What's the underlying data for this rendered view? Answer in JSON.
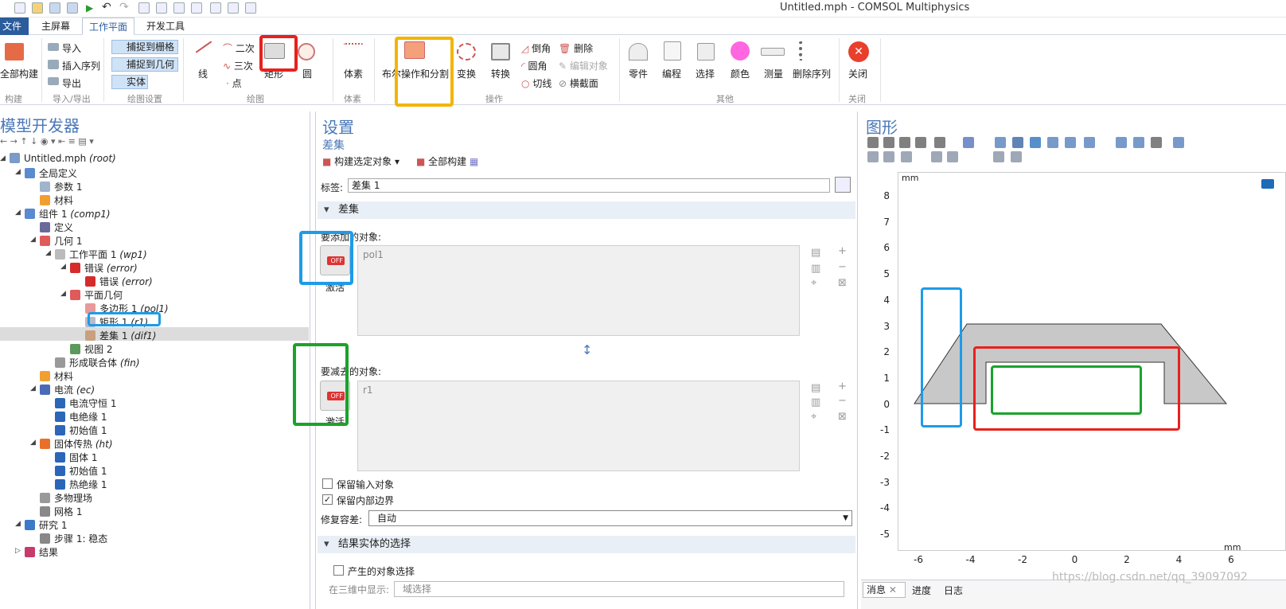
{
  "window": {
    "title": "Untitled.mph - COMSOL Multiphysics"
  },
  "tabs": {
    "file": "文件 ▾",
    "home": "主屏幕",
    "workplane": "工作平面",
    "devtools": "开发工具"
  },
  "ribbon": {
    "build_all": "全部构建",
    "group_build": "构建",
    "import": "导入",
    "insert_sequence": "插入序列",
    "export": "导出",
    "group_io": "导入/导出",
    "snap_grid": "捕捉到栅格",
    "snap_geometry": "捕捉到几何",
    "solid": "实体",
    "group_draw_settings": "绘图设置",
    "line": "线",
    "quadratic": "二次",
    "cubic": "三次",
    "point": "点",
    "rectangle": "矩形",
    "circle": "圆",
    "group_draw": "绘图",
    "primitive": "体素",
    "group_primitive": "体素",
    "boolean": "布尔操作和分割",
    "transform": "变换",
    "convert": "转换",
    "chamfer": "倒角",
    "fillet": "圆角",
    "tangent": "切线",
    "delete": "删除",
    "edit_object": "编辑对象",
    "cross_section": "横截面",
    "group_ops": "操作",
    "parts": "零件",
    "programming": "编程",
    "selection": "选择",
    "color": "颜色",
    "measure": "测量",
    "delete_sequence": "删除序列",
    "group_other": "其他",
    "close": "关闭",
    "group_close": "关闭"
  },
  "left_panel": {
    "title": "模型开发器",
    "tree": [
      {
        "label": "Untitled.mph",
        "suffix": "(root)"
      },
      {
        "label": "全局定义",
        "suffix": ""
      },
      {
        "label": "参数 1",
        "suffix": ""
      },
      {
        "label": "材料",
        "suffix": ""
      },
      {
        "label": "组件 1",
        "suffix": "(comp1)"
      },
      {
        "label": "定义",
        "suffix": ""
      },
      {
        "label": "几何 1",
        "suffix": ""
      },
      {
        "label": "工作平面 1",
        "suffix": "(wp1)"
      },
      {
        "label": "错误",
        "suffix": "(error)"
      },
      {
        "label": "错误",
        "suffix": "(error)"
      },
      {
        "label": "平面几何",
        "suffix": ""
      },
      {
        "label": "多边形 1",
        "suffix": "(pol1)"
      },
      {
        "label": "矩形 1",
        "suffix": "(r1)"
      },
      {
        "label": "差集 1",
        "suffix": "(dif1)"
      },
      {
        "label": "视图 2",
        "suffix": ""
      },
      {
        "label": "形成联合体",
        "suffix": "(fin)"
      },
      {
        "label": "材料",
        "suffix": ""
      },
      {
        "label": "电流",
        "suffix": "(ec)"
      },
      {
        "label": "电流守恒 1",
        "suffix": ""
      },
      {
        "label": "电绝缘 1",
        "suffix": ""
      },
      {
        "label": "初始值 1",
        "suffix": ""
      },
      {
        "label": "固体传热",
        "suffix": "(ht)"
      },
      {
        "label": "固体 1",
        "suffix": ""
      },
      {
        "label": "初始值 1",
        "suffix": ""
      },
      {
        "label": "热绝缘 1",
        "suffix": ""
      },
      {
        "label": "多物理场",
        "suffix": ""
      },
      {
        "label": "网格 1",
        "suffix": ""
      },
      {
        "label": "研究 1",
        "suffix": ""
      },
      {
        "label": "步骤 1: 稳态",
        "suffix": ""
      },
      {
        "label": "结果",
        "suffix": ""
      }
    ]
  },
  "settings": {
    "title": "设置",
    "subtitle": "差集",
    "build_selected": "构建选定对象",
    "build_all": "全部构建",
    "label_caption": "标签:",
    "label_value": "差集 1",
    "section_difference": "差集",
    "objects_add_caption": "要添加的对象:",
    "objects_add_value": "pol1",
    "activate_1": "激活",
    "objects_subtract_caption": "要减去的对象:",
    "objects_subtract_value": "r1",
    "activate_2": "激活",
    "keep_input": "保留输入对象",
    "keep_interior": "保留内部边界",
    "repair_tol_caption": "修复容差:",
    "repair_tol_value": "自动",
    "section_result": "结果实体的选择",
    "resulting_selection": "产生的对象选择",
    "show_in_3d_caption": "在三维中显示:",
    "show_in_3d_value": "域选择"
  },
  "graphics": {
    "title": "图形",
    "unit_top": "mm",
    "unit_right": "mm",
    "y_ticks": [
      "8",
      "7",
      "6",
      "5",
      "4",
      "3",
      "2",
      "1",
      "0",
      "-1",
      "-2",
      "-3",
      "-4",
      "-5"
    ],
    "x_ticks": [
      "-6",
      "-4",
      "-2",
      "0",
      "2",
      "4",
      "6"
    ],
    "tabs": [
      "消息",
      "进度",
      "日志"
    ]
  },
  "watermark": "https://blog.csdn.net/qq_39097092",
  "colors": {
    "highlight_red": "#e8211d",
    "highlight_blue": "#1e9be8",
    "highlight_green": "#1aa32a",
    "highlight_yellow": "#f4b400",
    "accent": "#2b5c9c"
  }
}
